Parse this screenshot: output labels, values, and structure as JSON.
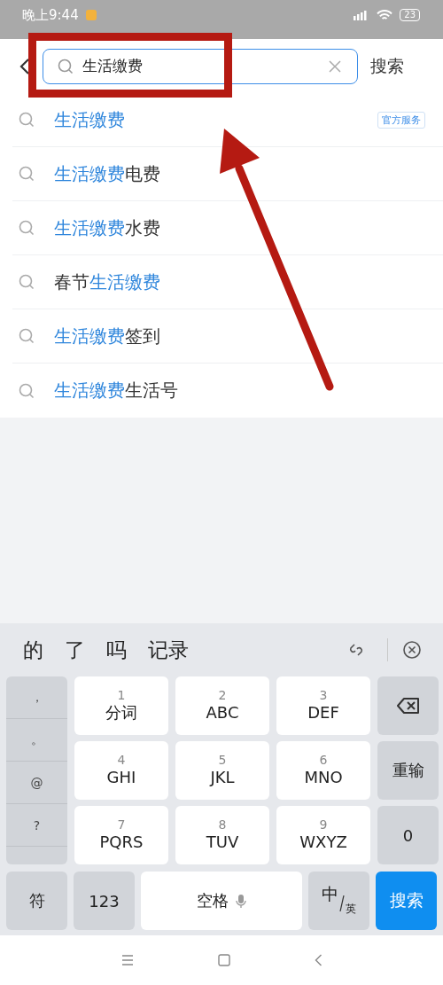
{
  "status_bar": {
    "time": "晚上9:44",
    "battery": "23"
  },
  "search": {
    "value": "生活缴费",
    "button": "搜索"
  },
  "suggestions": [
    {
      "segments": [
        {
          "text": "生活缴费",
          "highlight": true
        }
      ],
      "badge": "官方服务"
    },
    {
      "segments": [
        {
          "text": "生活缴费",
          "highlight": true
        },
        {
          "text": "电费",
          "highlight": false
        }
      ]
    },
    {
      "segments": [
        {
          "text": "生活缴费",
          "highlight": true
        },
        {
          "text": "水费",
          "highlight": false
        }
      ]
    },
    {
      "segments": [
        {
          "text": "春节",
          "highlight": false
        },
        {
          "text": "生活缴费",
          "highlight": true
        }
      ]
    },
    {
      "segments": [
        {
          "text": "生活缴费",
          "highlight": true
        },
        {
          "text": "签到",
          "highlight": false
        }
      ]
    },
    {
      "segments": [
        {
          "text": "生活缴费",
          "highlight": true
        },
        {
          "text": "生活号",
          "highlight": false
        }
      ]
    }
  ],
  "keyboard": {
    "candidates": [
      "的",
      "了",
      "吗",
      "记录"
    ],
    "symbols": [
      "，",
      "。",
      "@",
      "?"
    ],
    "keys": [
      {
        "digit": "1",
        "letters": "分词"
      },
      {
        "digit": "2",
        "letters": "ABC"
      },
      {
        "digit": "3",
        "letters": "DEF"
      },
      {
        "digit": "4",
        "letters": "GHI"
      },
      {
        "digit": "5",
        "letters": "JKL"
      },
      {
        "digit": "6",
        "letters": "MNO"
      },
      {
        "digit": "7",
        "letters": "PQRS"
      },
      {
        "digit": "8",
        "letters": "TUV"
      },
      {
        "digit": "9",
        "letters": "WXYZ"
      }
    ],
    "reinput": "重输",
    "zero": "0",
    "symbol_key": "符",
    "number_key": "123",
    "space_key": "空格",
    "lang_main": "中",
    "lang_sub": "英",
    "enter_key": "搜索"
  }
}
